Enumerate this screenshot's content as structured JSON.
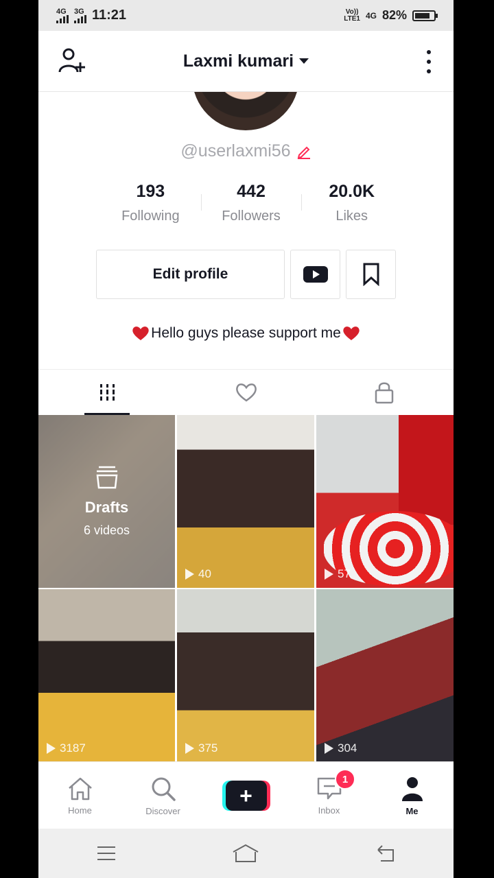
{
  "status_bar": {
    "sim1": "4G",
    "sim2": "3G",
    "time": "11:21",
    "volte": "Vo))",
    "lte": "LTE1",
    "network": "4G",
    "battery_pct": "82%",
    "battery_level": 0.82
  },
  "header": {
    "title": "Laxmi kumari"
  },
  "profile": {
    "username": "@userlaxmi56",
    "stats": [
      {
        "value": "193",
        "label": "Following"
      },
      {
        "value": "442",
        "label": "Followers"
      },
      {
        "value": "20.0K",
        "label": "Likes"
      }
    ],
    "edit_label": "Edit profile",
    "bio": "Hello guys please support me"
  },
  "tabs": [
    "videos-grid-icon",
    "liked-heart-icon",
    "private-lock-icon"
  ],
  "grid": {
    "drafts_title": "Drafts",
    "drafts_count": "6 videos",
    "videos": [
      {
        "plays": "40"
      },
      {
        "plays": "57"
      },
      {
        "plays": "3187"
      },
      {
        "plays": "375"
      },
      {
        "plays": "304"
      }
    ]
  },
  "bottom_nav": {
    "home": "Home",
    "discover": "Discover",
    "create": "+",
    "inbox": "Inbox",
    "inbox_badge": "1",
    "me": "Me"
  },
  "colors": {
    "accent": "#fe2c55",
    "cyan": "#25f4ee",
    "text": "#161823",
    "muted": "#8a8b91"
  }
}
